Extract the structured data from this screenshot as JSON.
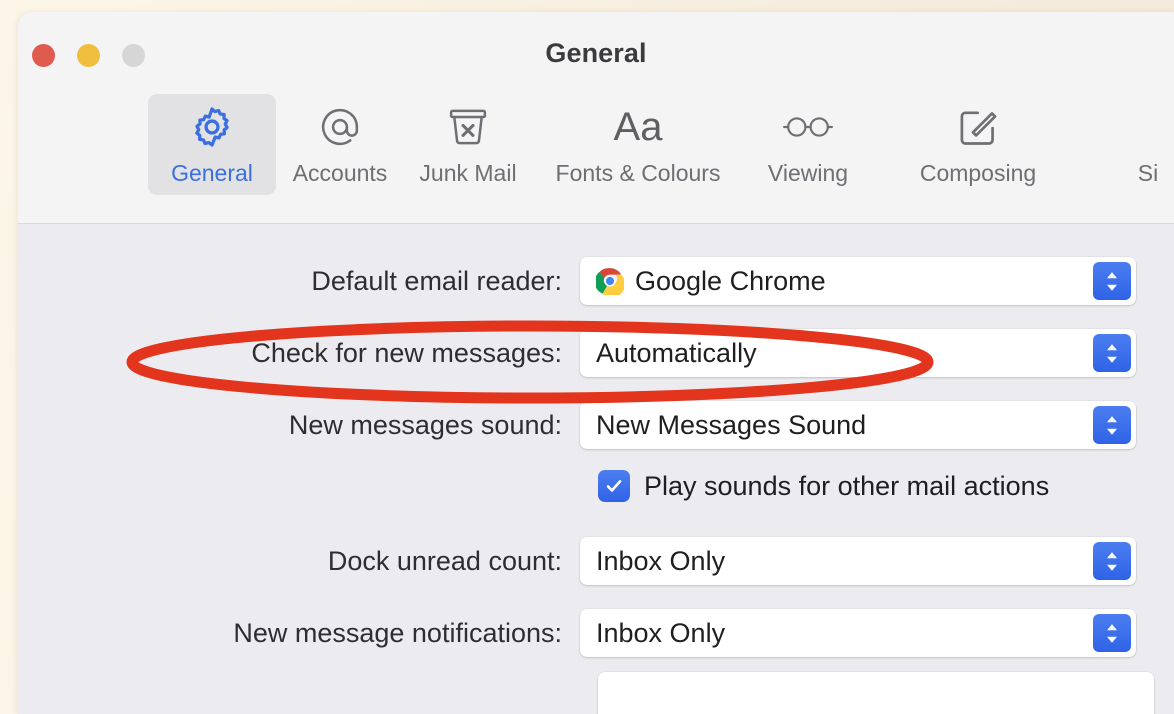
{
  "window": {
    "title": "General",
    "traffic_lights": [
      {
        "name": "close",
        "color": "#E05A4E"
      },
      {
        "name": "minimize",
        "color": "#EFBE3F"
      },
      {
        "name": "zoom",
        "color": "#D6D6D6"
      }
    ]
  },
  "toolbar": {
    "selected": "General",
    "tabs": [
      {
        "label": "General",
        "icon": "gear-icon"
      },
      {
        "label": "Accounts",
        "icon": "at-sign-icon"
      },
      {
        "label": "Junk Mail",
        "icon": "junk-bin-icon"
      },
      {
        "label": "Fonts & Colours",
        "icon": "fonts-aa-icon"
      },
      {
        "label": "Viewing",
        "icon": "glasses-icon"
      },
      {
        "label": "Composing",
        "icon": "compose-pencil-icon"
      },
      {
        "label": "Si",
        "icon": "signature-icon"
      }
    ]
  },
  "settings": {
    "default_reader": {
      "label": "Default email reader:",
      "value": "Google Chrome",
      "icon": "chrome-icon"
    },
    "check_messages": {
      "label": "Check for new messages:",
      "value": "Automatically"
    },
    "new_messages_sound": {
      "label": "New messages sound:",
      "value": "New Messages Sound"
    },
    "play_sounds": {
      "label": "Play sounds for other mail actions",
      "checked": true
    },
    "dock_unread": {
      "label": "Dock unread count:",
      "value": "Inbox Only"
    },
    "new_message_notifications": {
      "label": "New message notifications:",
      "value": "Inbox Only"
    }
  },
  "annotation": {
    "shape": "ellipse",
    "color": "#E3351E",
    "targets": "check-for-new-messages-row"
  },
  "colors": {
    "accent_blue": "#3B6FE0",
    "stepper_blue": "#2F63E6",
    "toolbar_bg": "#F4F4F5",
    "content_bg": "#ECECF0",
    "annotation_red": "#E3351E"
  }
}
